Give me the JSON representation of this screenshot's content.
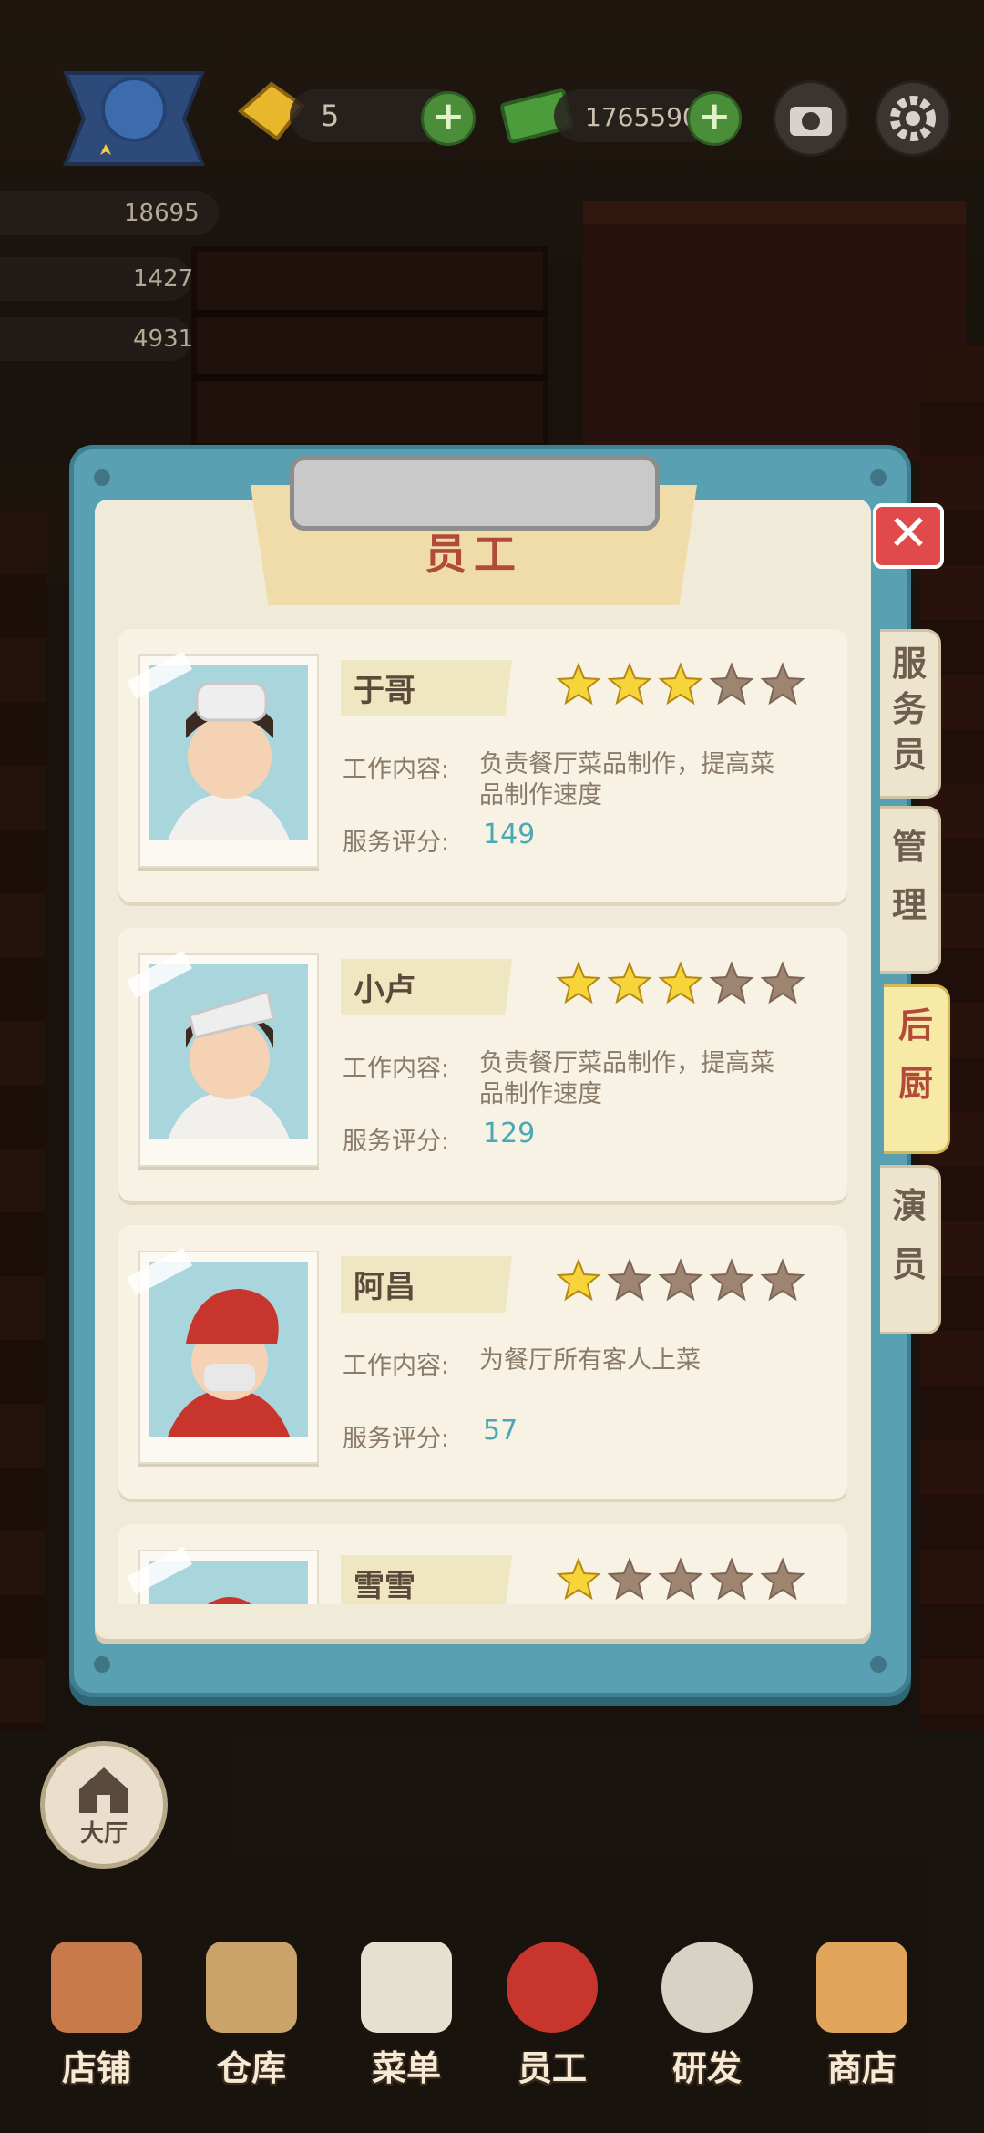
{
  "hud": {
    "diamonds": "5",
    "cash": "1765590",
    "stats": [
      "18695",
      "1427",
      "4931"
    ]
  },
  "dialog": {
    "title": "员工",
    "close_label": "✕",
    "desc_label": "工作内容:",
    "score_label": "服务评分:",
    "tabs": [
      {
        "label": "服\n务\n员",
        "active": false
      },
      {
        "label": "管\n理",
        "active": false
      },
      {
        "label": "后\n厨",
        "active": true
      },
      {
        "label": "演\n员",
        "active": false
      }
    ],
    "staff": [
      {
        "name": "于哥",
        "stars": 3,
        "desc": "负责餐厅菜品制作，提高菜品制作速度",
        "score": "149"
      },
      {
        "name": "小卢",
        "stars": 3,
        "desc": "负责餐厅菜品制作，提高菜品制作速度",
        "score": "129"
      },
      {
        "name": "阿昌",
        "stars": 1,
        "desc": "为餐厅所有客人上菜",
        "score": "57"
      },
      {
        "name": "雪雪",
        "stars": 1,
        "desc": "",
        "score": ""
      }
    ]
  },
  "lobby_label": "大厅",
  "nav": [
    "店铺",
    "仓库",
    "菜单",
    "员工",
    "研发",
    "商店"
  ],
  "colors": {
    "star_on": "#f7d53a",
    "star_off": "#9e8572",
    "accent": "#4aa9b5"
  }
}
